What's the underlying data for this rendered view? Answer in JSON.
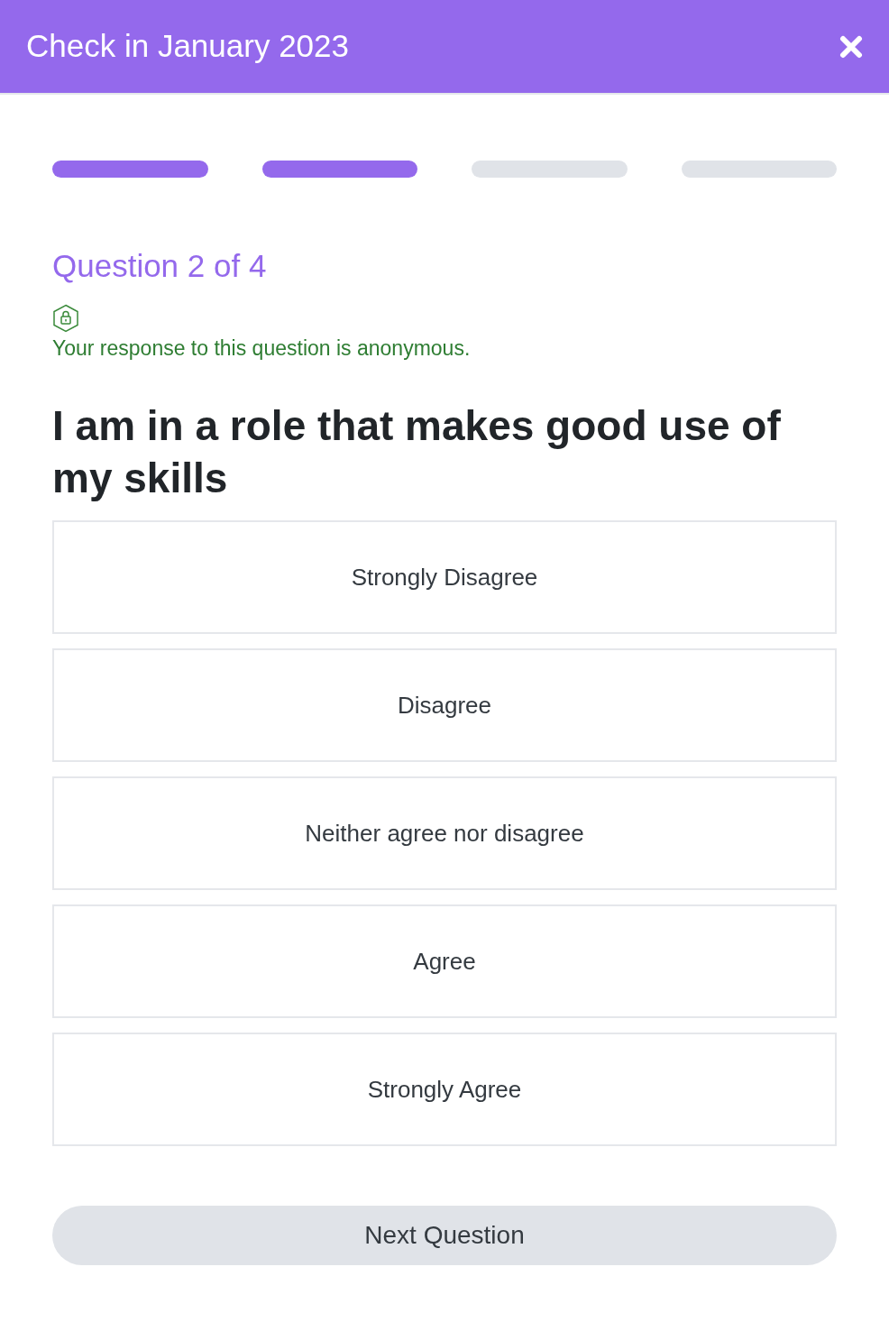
{
  "header": {
    "title": "Check in January 2023"
  },
  "progress": [
    {
      "done": true
    },
    {
      "done": true
    },
    {
      "done": false
    },
    {
      "done": false
    }
  ],
  "question": {
    "counter": "Question 2 of 4",
    "privacy_note": "Your response to this question is anonymous.",
    "text": "I am in a role that makes good use of my skills"
  },
  "options": [
    {
      "label": "Strongly Disagree",
      "selected": false
    },
    {
      "label": "Disagree",
      "selected": false
    },
    {
      "label": "Neither agree nor disagree",
      "selected": false
    },
    {
      "label": "Agree",
      "selected": false
    },
    {
      "label": "Strongly Agree",
      "selected": false
    }
  ],
  "next_button": {
    "label": "Next Question",
    "disabled": true
  }
}
